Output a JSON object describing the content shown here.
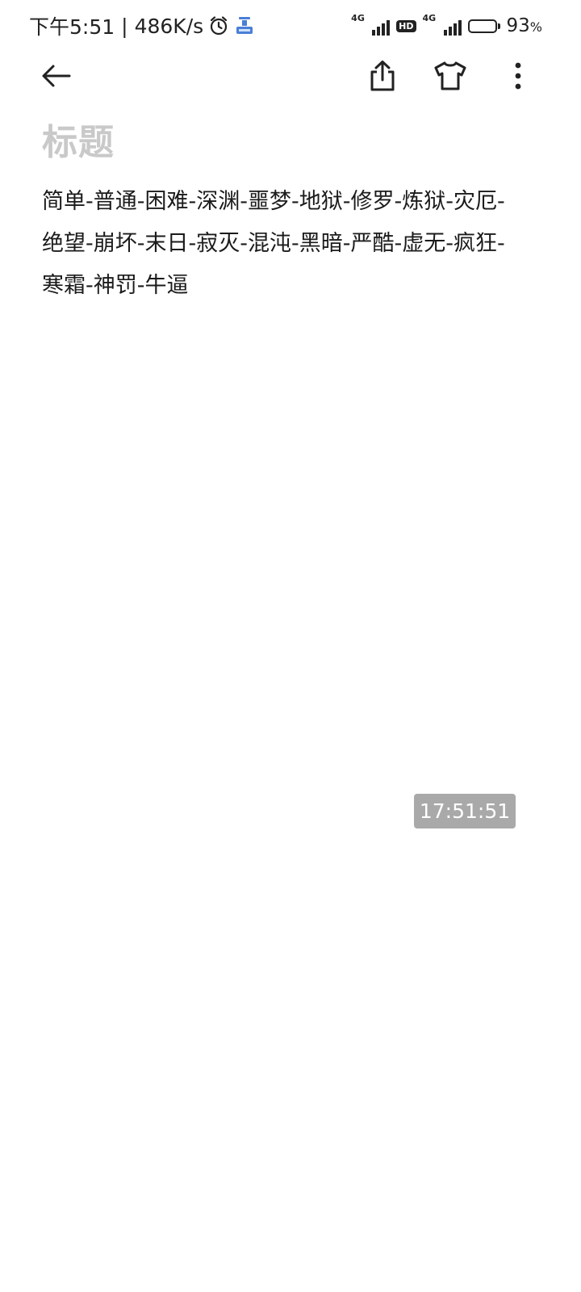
{
  "status_bar": {
    "time": "下午5:51",
    "separator": "|",
    "net_speed": "486K/s",
    "signal1_label": "4G",
    "hd_label": "HD",
    "signal2_label": "4G",
    "battery_percent": "93",
    "battery_sign": "%",
    "battery_level": 0.93
  },
  "toolbar": {
    "back_icon": "arrow-left-icon",
    "share_icon": "share-icon",
    "theme_icon": "tshirt-icon",
    "more_icon": "more-vertical-icon"
  },
  "note": {
    "title_placeholder": "标题",
    "body": "简单-普通-困难-深渊-噩梦-地狱-修罗-炼狱-灾厄-绝望-崩坏-末日-寂灭-混沌-黑暗-严酷-虚无-疯狂-寒霜-神罚-牛逼"
  },
  "timestamp": "17:51:51",
  "colors": {
    "title_placeholder": "#c9c9c9",
    "body_text": "#1b1b1b",
    "badge_bg": "#a9a9a9"
  }
}
